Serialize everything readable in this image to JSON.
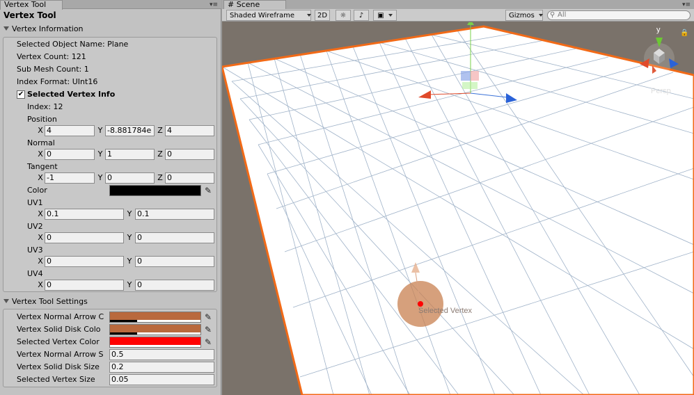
{
  "inspector": {
    "tab_title": "Vertex Tool",
    "panel_title": "Vertex Tool",
    "info": {
      "header": "Vertex Information",
      "object_name": "Selected Object Name: Plane",
      "vertex_count": "Vertex Count: 121",
      "submesh_count": "Sub Mesh Count: 1",
      "index_format": "Index Format: UInt16",
      "vertex_info_label": "Selected Vertex Info",
      "vertex_info_checked": true,
      "index": "Index: 12",
      "position": {
        "label": "Position",
        "x": "4",
        "y": "-8.881784e",
        "z": "4"
      },
      "normal": {
        "label": "Normal",
        "x": "0",
        "y": "1",
        "z": "0"
      },
      "tangent": {
        "label": "Tangent",
        "x": "-1",
        "y": "0",
        "z": "0"
      },
      "color": {
        "label": "Color",
        "value": "#000000"
      },
      "uv1": {
        "label": "UV1",
        "x": "0.1",
        "y": "0.1"
      },
      "uv2": {
        "label": "UV2",
        "x": "0",
        "y": "0"
      },
      "uv3": {
        "label": "UV3",
        "x": "0",
        "y": "0"
      },
      "uv4": {
        "label": "UV4",
        "x": "0",
        "y": "0"
      }
    },
    "settings": {
      "header": "Vertex Tool Settings",
      "normal_arrow_color": {
        "label": "Vertex Normal Arrow C",
        "value": "#b9693d"
      },
      "solid_disk_color": {
        "label": "Vertex Solid Disk Colo",
        "value": "#b9693d"
      },
      "selected_vertex_color": {
        "label": "Selected Vertex Color",
        "value": "#ff0000"
      },
      "normal_arrow_size": {
        "label": "Vertex Normal Arrow S",
        "value": "0.5"
      },
      "solid_disk_size": {
        "label": "Vertex Solid Disk Size",
        "value": "0.2"
      },
      "selected_vertex_size": {
        "label": "Selected Vertex Size",
        "value": "0.05"
      }
    }
  },
  "scene": {
    "tab_title": "Scene",
    "toolbar": {
      "shading": "Shaded Wireframe",
      "mode_2d": "2D",
      "gizmos": "Gizmos",
      "search_placeholder": "All"
    },
    "vertex_label": "Selected Vertex",
    "persp_label": "Persp",
    "axis_y": "y",
    "colors": {
      "outline": "#f26a17",
      "grid": "#9fb2c8",
      "selected": "#ff0000",
      "disk": "#c88050"
    }
  }
}
